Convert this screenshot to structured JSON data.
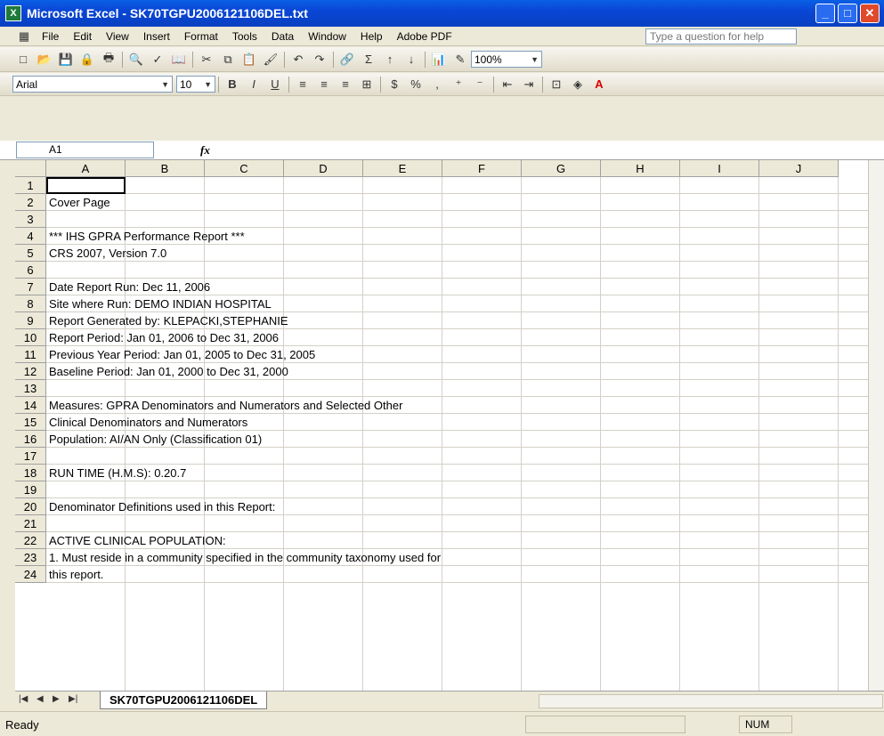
{
  "window": {
    "title": "Microsoft Excel - SK70TGPU2006121106DEL.txt",
    "app_icon": "X"
  },
  "menu": {
    "items": [
      "File",
      "Edit",
      "View",
      "Insert",
      "Format",
      "Tools",
      "Data",
      "Window",
      "Help",
      "Adobe PDF"
    ],
    "help_placeholder": "Type a question for help"
  },
  "toolbar": {
    "zoom": "100%",
    "font": "Arial",
    "font_size": "10",
    "bold": "B",
    "italic": "I",
    "underline": "U",
    "currency": "$",
    "percent": "%",
    "comma": ","
  },
  "formula_bar": {
    "name_box": "A1",
    "fx": "fx",
    "value": ""
  },
  "grid": {
    "columns": [
      "A",
      "B",
      "C",
      "D",
      "E",
      "F",
      "G",
      "H",
      "I",
      "J"
    ],
    "rows": [
      {
        "n": "1",
        "text": ""
      },
      {
        "n": "2",
        "text": "Cover Page"
      },
      {
        "n": "3",
        "text": ""
      },
      {
        "n": "4",
        "text": "*** IHS GPRA Performance Report ***"
      },
      {
        "n": "5",
        "text": "CRS 2007, Version 7.0"
      },
      {
        "n": "6",
        "text": ""
      },
      {
        "n": "7",
        "text": "Date Report Run: Dec 11, 2006"
      },
      {
        "n": "8",
        "text": "Site where Run: DEMO INDIAN HOSPITAL"
      },
      {
        "n": "9",
        "text": "Report Generated by: KLEPACKI,STEPHANIE"
      },
      {
        "n": "10",
        "text": "Report Period: Jan 01, 2006 to Dec 31, 2006"
      },
      {
        "n": "11",
        "text": "Previous Year Period:  Jan 01, 2005 to Dec 31, 2005"
      },
      {
        "n": "12",
        "text": "Baseline Period:  Jan 01, 2000 to Dec 31, 2000"
      },
      {
        "n": "13",
        "text": ""
      },
      {
        "n": "14",
        "text": "Measures: GPRA Denominators and Numerators and Selected Other"
      },
      {
        "n": "15",
        "text": "Clinical Denominators and Numerators"
      },
      {
        "n": "16",
        "text": "Population: AI/AN Only (Classification 01)"
      },
      {
        "n": "17",
        "text": ""
      },
      {
        "n": "18",
        "text": "RUN TIME (H.M.S): 0.20.7"
      },
      {
        "n": "19",
        "text": ""
      },
      {
        "n": "20",
        "text": "Denominator Definitions used in this Report:"
      },
      {
        "n": "21",
        "text": ""
      },
      {
        "n": "22",
        "text": "ACTIVE CLINICAL POPULATION:"
      },
      {
        "n": "23",
        "text": "1. Must reside in a community specified in the community taxonomy used for"
      },
      {
        "n": "24",
        "text": "this report."
      }
    ]
  },
  "sheet_tab": "SK70TGPU2006121106DEL",
  "status": {
    "ready": "Ready",
    "num": "NUM"
  }
}
